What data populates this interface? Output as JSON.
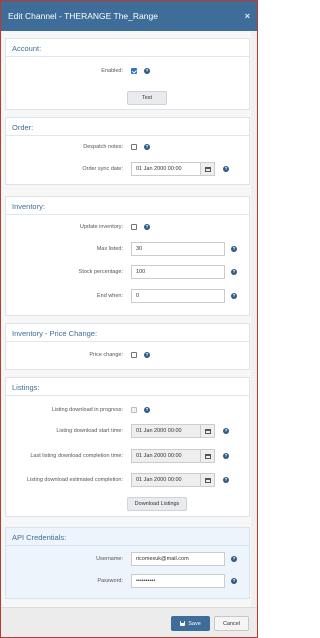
{
  "window": {
    "title": "Edit Channel - THERANGE The_Range",
    "close_glyph": "×"
  },
  "help_glyph": "?",
  "account": {
    "heading": "Account:",
    "enabled_label": "Enabled:",
    "enabled_checked": true,
    "test_button": "Test"
  },
  "order": {
    "heading": "Order:",
    "despatch_label": "Despatch notes:",
    "despatch_checked": false,
    "sync_label": "Order sync date:",
    "sync_value": "01 Jan 2000 00:00"
  },
  "inventory": {
    "heading": "Inventory:",
    "update_label": "Update inventory:",
    "update_checked": false,
    "max_label": "Max listed:",
    "max_value": "30",
    "stock_label": "Stock percentage:",
    "stock_value": "100",
    "end_label": "End when:",
    "end_value": "0"
  },
  "price_change": {
    "heading": "Inventory - Price Change:",
    "label": "Price change:",
    "checked": false
  },
  "listings": {
    "heading": "Listings:",
    "progress_label": "Listing download in progress:",
    "progress_checked": false,
    "start_label": "Listing download start time:",
    "start_value": "01 Jan 2000 00:00",
    "last_label": "Last listing download completion time:",
    "last_value": "01 Jan 2000 00:00",
    "est_label": "Listing download estimated completion:",
    "est_value": "01 Jan 2000 00:00",
    "download_button": "Download Listings"
  },
  "api": {
    "heading": "API Credentials:",
    "username_label": "Username:",
    "username_value": "ricomexuk@mail.com",
    "password_label": "Password:",
    "password_value": "••••••••••"
  },
  "footer": {
    "save": "Save",
    "cancel": "Cancel"
  },
  "colors": {
    "accent": "#3e6d99",
    "help": "#2d5a88",
    "checkbox": "#2f73c5",
    "window_border": "#c0392b"
  }
}
